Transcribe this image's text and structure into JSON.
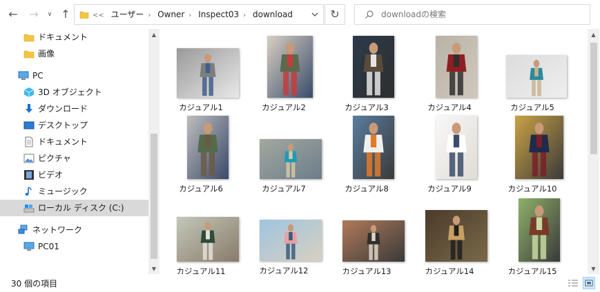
{
  "toolbar": {
    "back_glyph": "←",
    "forward_glyph": "→",
    "recent_glyph": "∨",
    "up_glyph": "↑",
    "refresh_glyph": "↻",
    "overflow_glyph": "<<"
  },
  "address": {
    "crumbs": [
      "ユーザー",
      "Owner",
      "Inspect03",
      "download"
    ],
    "separator_glyph": "›"
  },
  "search": {
    "placeholder": "downloadの検索"
  },
  "navigation": {
    "items": [
      {
        "label": "ドキュメント",
        "icon": "folder-icon",
        "level": 1
      },
      {
        "label": "画像",
        "icon": "folder-icon",
        "level": 1
      },
      {
        "label": "PC",
        "icon": "pc-icon",
        "level": 0
      },
      {
        "label": "3D オブジェクト",
        "icon": "3d-objects-icon",
        "level": 1
      },
      {
        "label": "ダウンロード",
        "icon": "download-icon",
        "level": 1
      },
      {
        "label": "デスクトップ",
        "icon": "desktop-icon",
        "level": 1
      },
      {
        "label": "ドキュメント",
        "icon": "document-icon",
        "level": 1
      },
      {
        "label": "ピクチャ",
        "icon": "pictures-icon",
        "level": 1
      },
      {
        "label": "ビデオ",
        "icon": "video-icon",
        "level": 1
      },
      {
        "label": "ミュージック",
        "icon": "music-icon",
        "level": 1
      },
      {
        "label": "ローカル ディスク (C:)",
        "icon": "local-disk-icon",
        "level": 1,
        "selected": true
      },
      {
        "label": "ネットワーク",
        "icon": "network-icon",
        "level": 0
      },
      {
        "label": "PC01",
        "icon": "pc-icon",
        "level": 1
      }
    ]
  },
  "files": [
    {
      "name": "カジュアル1"
    },
    {
      "name": "カジュアル2"
    },
    {
      "name": "カジュアル3"
    },
    {
      "name": "カジュアル4"
    },
    {
      "name": "カジュアル5"
    },
    {
      "name": "カジュアル6"
    },
    {
      "name": "カジュアル7"
    },
    {
      "name": "カジュアル8"
    },
    {
      "name": "カジュアル9"
    },
    {
      "name": "カジュアル10"
    },
    {
      "name": "カジュアル11"
    },
    {
      "name": "カジュアル12"
    },
    {
      "name": "カジュアル13"
    },
    {
      "name": "カジュアル14"
    },
    {
      "name": "カジュアル15"
    }
  ],
  "status": {
    "item_count": "30 個の項目"
  },
  "colors": {
    "folder": "#f4c542",
    "selected_nav": "#d9d9d9",
    "pc_blue": "#1e90ff",
    "scroll_track": "#f0f0f0",
    "scroll_thumb": "#cdcdcd"
  }
}
